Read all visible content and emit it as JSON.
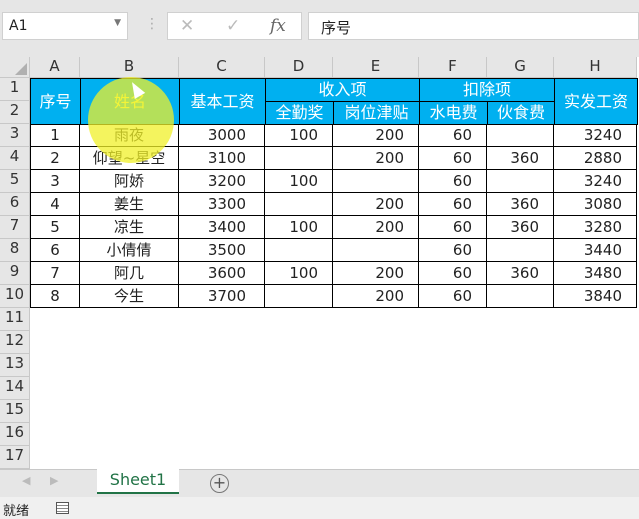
{
  "formula_bar": {
    "name_box": "A1",
    "cancel_icon": "✕",
    "enter_icon": "✓",
    "fx_label": "fx",
    "formula": "序号"
  },
  "columns": [
    "A",
    "B",
    "C",
    "D",
    "E",
    "F",
    "G",
    "H"
  ],
  "row_numbers": [
    "1",
    "2",
    "3",
    "4",
    "5",
    "6",
    "7",
    "8",
    "9",
    "10",
    "11",
    "12",
    "13",
    "14",
    "15",
    "16",
    "17"
  ],
  "headers": {
    "seq": "序号",
    "name": "姓名",
    "base": "基本工资",
    "income": "收入项",
    "attendance": "全勤奖",
    "post": "岗位津贴",
    "deduction": "扣除项",
    "utility": "水电费",
    "meal": "伙食费",
    "net": "实发工资"
  },
  "rows": [
    [
      "1",
      "雨夜",
      "3000",
      "100",
      "200",
      "60",
      "",
      "3240"
    ],
    [
      "2",
      "仰望~星空",
      "3100",
      "",
      "200",
      "60",
      "360",
      "2880"
    ],
    [
      "3",
      "阿娇",
      "3200",
      "100",
      "",
      "60",
      "",
      "3240"
    ],
    [
      "4",
      "姜生",
      "3300",
      "",
      "200",
      "60",
      "360",
      "3080"
    ],
    [
      "5",
      "凉生",
      "3400",
      "100",
      "200",
      "60",
      "360",
      "3280"
    ],
    [
      "6",
      "小倩倩",
      "3500",
      "",
      "",
      "60",
      "",
      "3440"
    ],
    [
      "7",
      "阿几",
      "3600",
      "100",
      "200",
      "60",
      "360",
      "3480"
    ],
    [
      "8",
      "今生",
      "3700",
      "",
      "200",
      "60",
      "",
      "3840"
    ]
  ],
  "sheet_tabs": [
    "Sheet1"
  ],
  "add_sheet": "+",
  "status": "就绪",
  "colors": {
    "header_bg": "#00b0f0",
    "tab_accent": "#217346"
  }
}
